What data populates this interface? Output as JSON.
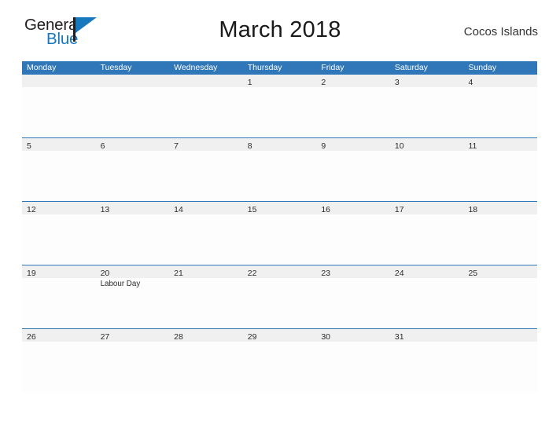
{
  "logo": {
    "word_one": "General",
    "word_two": "Blue",
    "flag_icon": "flag-triangle-icon",
    "dark_color": "#231f20",
    "blue_color": "#1878be"
  },
  "header": {
    "title": "March 2018",
    "location": "Cocos Islands"
  },
  "theme": {
    "header_blue": "#2f77b8",
    "row_divider_blue": "#2f77b8",
    "date_band_gray": "#f0f0f0",
    "text_dark": "#2b2b2b",
    "page_background": "#ffffff"
  },
  "calendar": {
    "month": "March",
    "year": "2018",
    "weekdays": [
      "Monday",
      "Tuesday",
      "Wednesday",
      "Thursday",
      "Friday",
      "Saturday",
      "Sunday"
    ],
    "weeks": [
      [
        {
          "date": "",
          "events": []
        },
        {
          "date": "",
          "events": []
        },
        {
          "date": "",
          "events": []
        },
        {
          "date": "1",
          "events": []
        },
        {
          "date": "2",
          "events": []
        },
        {
          "date": "3",
          "events": []
        },
        {
          "date": "4",
          "events": []
        }
      ],
      [
        {
          "date": "5",
          "events": []
        },
        {
          "date": "6",
          "events": []
        },
        {
          "date": "7",
          "events": []
        },
        {
          "date": "8",
          "events": []
        },
        {
          "date": "9",
          "events": []
        },
        {
          "date": "10",
          "events": []
        },
        {
          "date": "11",
          "events": []
        }
      ],
      [
        {
          "date": "12",
          "events": []
        },
        {
          "date": "13",
          "events": []
        },
        {
          "date": "14",
          "events": []
        },
        {
          "date": "15",
          "events": []
        },
        {
          "date": "16",
          "events": []
        },
        {
          "date": "17",
          "events": []
        },
        {
          "date": "18",
          "events": []
        }
      ],
      [
        {
          "date": "19",
          "events": []
        },
        {
          "date": "20",
          "events": [
            "Labour Day"
          ]
        },
        {
          "date": "21",
          "events": []
        },
        {
          "date": "22",
          "events": []
        },
        {
          "date": "23",
          "events": []
        },
        {
          "date": "24",
          "events": []
        },
        {
          "date": "25",
          "events": []
        }
      ],
      [
        {
          "date": "26",
          "events": []
        },
        {
          "date": "27",
          "events": []
        },
        {
          "date": "28",
          "events": []
        },
        {
          "date": "29",
          "events": []
        },
        {
          "date": "30",
          "events": []
        },
        {
          "date": "31",
          "events": []
        },
        {
          "date": "",
          "events": []
        }
      ]
    ]
  }
}
